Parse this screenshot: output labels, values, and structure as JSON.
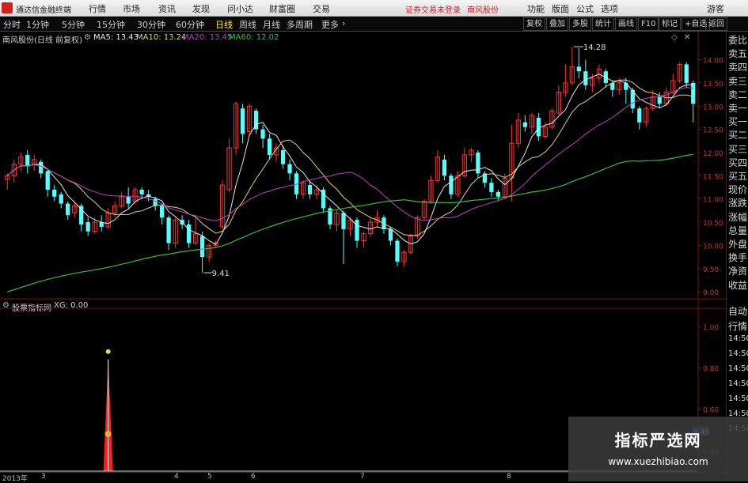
{
  "menubar": {
    "app_title": "通达信金融终端",
    "items": [
      "行情",
      "市场",
      "资讯",
      "发现",
      "问小达",
      "财富圈",
      "交易"
    ],
    "warning": "证券交易未登录",
    "stock_link": "南风股份",
    "right_items": [
      "功能",
      "版面",
      "公式",
      "选项"
    ],
    "guest": "游客"
  },
  "toolbar": {
    "periods": [
      "分时",
      "1分钟",
      "5分钟",
      "15分钟",
      "30分钟",
      "60分钟",
      "日线",
      "周线",
      "月线",
      "多周期",
      "更多"
    ],
    "active_period": "日线",
    "right_buttons": [
      "复权",
      "叠加",
      "多股",
      "统计",
      "画线",
      "F10",
      "标记",
      "+自选",
      "返回"
    ]
  },
  "main_legend": {
    "title": "南风股份(日线 前复权)",
    "ma5": "MA5: 13.43",
    "ma10": "MA10: 13.24",
    "ma20": "MA20: 13.45",
    "ma60": "MA60: 12.02"
  },
  "sub_legend": {
    "title": "股票指标网",
    "xg": "XG: 0.00"
  },
  "colors": {
    "up": "#ff3232",
    "down": "#54ffff",
    "ma5": "#e8e8e8",
    "ma10": "#e6d56b",
    "ma20": "#c040c0",
    "ma60": "#30c030",
    "indicator": "#ff1c1c"
  },
  "annotations": {
    "high": "14.28",
    "low": "9.41"
  },
  "price_axis": [
    "14.00",
    "13.50",
    "13.00",
    "12.50",
    "12.00",
    "11.50",
    "11.00",
    "10.50",
    "10.00",
    "9.50",
    "9.00"
  ],
  "sub_axis": [
    "1.00",
    "0.80",
    "0.60",
    "0.49",
    "0.40"
  ],
  "x_axis": [
    "2013年",
    "3",
    "4",
    "5",
    "6",
    "7",
    "8"
  ],
  "right_panel": {
    "items": [
      "委比",
      "卖五",
      "卖四",
      "卖三",
      "卖二",
      "卖一",
      "买一",
      "买二",
      "买三",
      "买四",
      "买五",
      "现价",
      "涨跌",
      "涨幅",
      "总量",
      "外盘",
      "换手",
      "净资",
      "收益"
    ],
    "lower": [
      "自动",
      "行情",
      "14:50",
      "14:50",
      "14:50",
      "14:50",
      "14:50",
      "14:50",
      "14:50"
    ]
  },
  "watermark": {
    "title": "指标严选网",
    "url": "www.xuezhibiao.com"
  },
  "chart_data": {
    "type": "candlestick",
    "ylim": [
      8.9,
      14.35
    ],
    "candles": [
      [
        11.42,
        11.5,
        11.2,
        11.55
      ],
      [
        11.5,
        11.75,
        11.35,
        11.85
      ],
      [
        11.75,
        11.9,
        11.6,
        12.0
      ],
      [
        11.95,
        11.7,
        11.55,
        12.05
      ],
      [
        11.75,
        11.85,
        11.6,
        11.95
      ],
      [
        11.8,
        11.55,
        11.45,
        11.85
      ],
      [
        11.6,
        11.2,
        11.05,
        11.65
      ],
      [
        11.2,
        11.05,
        10.95,
        11.3
      ],
      [
        11.1,
        10.9,
        10.8,
        11.15
      ],
      [
        10.9,
        10.65,
        10.55,
        10.95
      ],
      [
        10.7,
        10.85,
        10.6,
        10.95
      ],
      [
        10.85,
        10.45,
        10.3,
        10.9
      ],
      [
        10.5,
        10.3,
        10.2,
        10.6
      ],
      [
        10.3,
        10.5,
        10.25,
        10.6
      ],
      [
        10.5,
        10.4,
        10.3,
        10.65
      ],
      [
        10.4,
        10.7,
        10.35,
        10.8
      ],
      [
        10.7,
        10.85,
        10.6,
        10.95
      ],
      [
        10.85,
        11.05,
        10.8,
        11.15
      ],
      [
        11.05,
        10.9,
        10.8,
        11.25
      ],
      [
        10.95,
        11.2,
        10.9,
        11.25
      ],
      [
        11.2,
        11.1,
        11.0,
        11.25
      ],
      [
        11.1,
        11.05,
        10.95,
        11.2
      ],
      [
        11.0,
        10.85,
        10.75,
        11.05
      ],
      [
        10.85,
        10.6,
        10.45,
        10.9
      ],
      [
        10.6,
        10.05,
        9.9,
        10.65
      ],
      [
        10.05,
        10.55,
        9.95,
        10.6
      ],
      [
        10.55,
        10.45,
        10.35,
        10.65
      ],
      [
        10.45,
        10.05,
        9.95,
        10.55
      ],
      [
        10.05,
        10.25,
        10.0,
        10.6
      ],
      [
        10.2,
        9.75,
        9.41,
        10.3
      ],
      [
        9.75,
        10.0,
        9.65,
        10.05
      ],
      [
        10.0,
        10.05,
        9.95,
        10.1
      ],
      [
        10.4,
        11.3,
        10.35,
        11.4
      ],
      [
        11.2,
        12.1,
        11.15,
        12.3
      ],
      [
        12.1,
        13.05,
        11.95,
        13.1
      ],
      [
        12.95,
        12.4,
        12.2,
        13.05
      ],
      [
        12.45,
        13.0,
        12.35,
        13.05
      ],
      [
        12.9,
        12.5,
        12.4,
        12.95
      ],
      [
        12.5,
        12.3,
        12.1,
        12.6
      ],
      [
        12.3,
        11.95,
        11.85,
        12.4
      ],
      [
        11.95,
        12.1,
        11.8,
        12.2
      ],
      [
        12.05,
        11.75,
        11.65,
        12.15
      ],
      [
        11.75,
        11.55,
        11.4,
        11.85
      ],
      [
        11.55,
        11.1,
        11.0,
        11.6
      ],
      [
        11.1,
        11.35,
        11.0,
        11.4
      ],
      [
        11.3,
        11.1,
        11.0,
        11.4
      ],
      [
        11.1,
        11.2,
        11.0,
        11.3
      ],
      [
        11.2,
        10.8,
        10.7,
        11.25
      ],
      [
        10.8,
        10.45,
        10.35,
        10.85
      ],
      [
        10.45,
        10.7,
        10.3,
        10.75
      ],
      [
        10.7,
        10.35,
        9.6,
        10.75
      ],
      [
        10.35,
        10.55,
        10.2,
        10.6
      ],
      [
        10.55,
        10.1,
        9.95,
        10.6
      ],
      [
        10.1,
        10.25,
        9.95,
        10.3
      ],
      [
        10.25,
        10.5,
        10.2,
        10.6
      ],
      [
        10.5,
        10.6,
        10.4,
        10.75
      ],
      [
        10.6,
        10.35,
        10.25,
        10.65
      ],
      [
        10.35,
        10.1,
        10.0,
        10.4
      ],
      [
        10.1,
        9.65,
        9.55,
        10.15
      ],
      [
        9.65,
        9.85,
        9.55,
        9.9
      ],
      [
        9.85,
        10.2,
        9.8,
        10.25
      ],
      [
        10.2,
        10.6,
        10.15,
        10.65
      ],
      [
        10.6,
        10.95,
        10.55,
        11.0
      ],
      [
        10.95,
        11.4,
        10.9,
        11.5
      ],
      [
        11.4,
        11.9,
        11.35,
        12.05
      ],
      [
        11.85,
        11.5,
        11.4,
        11.95
      ],
      [
        11.5,
        11.1,
        11.0,
        11.55
      ],
      [
        11.1,
        11.5,
        11.05,
        11.6
      ],
      [
        11.5,
        11.95,
        11.45,
        12.1
      ],
      [
        11.95,
        12.05,
        11.8,
        12.1
      ],
      [
        12.0,
        11.55,
        11.45,
        12.05
      ],
      [
        11.55,
        11.35,
        11.25,
        11.6
      ],
      [
        11.35,
        11.15,
        11.05,
        11.45
      ],
      [
        11.15,
        11.05,
        10.95,
        11.2
      ],
      [
        11.05,
        11.45,
        11.0,
        11.55
      ],
      [
        11.45,
        12.2,
        10.95,
        12.6
      ],
      [
        12.2,
        12.7,
        12.1,
        12.85
      ],
      [
        12.65,
        12.55,
        12.45,
        12.8
      ],
      [
        12.55,
        12.8,
        12.4,
        12.85
      ],
      [
        12.75,
        12.35,
        12.25,
        12.85
      ],
      [
        12.35,
        12.55,
        12.3,
        12.65
      ],
      [
        12.55,
        12.9,
        12.5,
        12.95
      ],
      [
        12.85,
        13.3,
        12.8,
        13.45
      ],
      [
        13.3,
        13.5,
        13.2,
        13.9
      ],
      [
        13.5,
        13.85,
        13.45,
        14.28
      ],
      [
        13.85,
        13.75,
        13.6,
        14.25
      ],
      [
        13.75,
        13.45,
        13.35,
        14.0
      ],
      [
        13.45,
        13.6,
        13.3,
        13.7
      ],
      [
        13.6,
        13.8,
        13.5,
        13.9
      ],
      [
        13.75,
        13.5,
        13.4,
        13.8
      ],
      [
        13.5,
        13.35,
        13.2,
        13.55
      ],
      [
        13.35,
        13.5,
        13.25,
        13.6
      ],
      [
        13.5,
        13.35,
        13.05,
        13.6
      ],
      [
        13.35,
        12.95,
        12.85,
        13.4
      ],
      [
        12.95,
        12.65,
        12.5,
        13.0
      ],
      [
        12.65,
        12.95,
        12.55,
        13.0
      ],
      [
        12.95,
        13.2,
        12.9,
        13.35
      ],
      [
        13.2,
        13.05,
        12.95,
        13.3
      ],
      [
        13.05,
        13.3,
        13.0,
        13.4
      ],
      [
        13.3,
        13.55,
        13.25,
        13.7
      ],
      [
        13.55,
        13.9,
        13.5,
        13.95
      ],
      [
        13.9,
        13.5,
        13.4,
        13.95
      ],
      [
        13.5,
        13.05,
        12.65,
        13.55
      ]
    ],
    "indicator_peak_index": 15,
    "indicator_peak_value": 0.84
  }
}
